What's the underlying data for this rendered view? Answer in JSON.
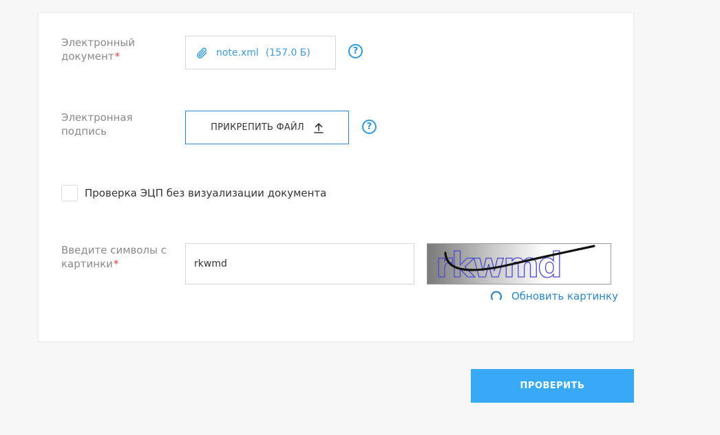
{
  "form": {
    "document": {
      "label_line1": "Электронный",
      "label_line2": "документ",
      "required_mark": "*",
      "file_name": "note.xml",
      "file_size": "(157.0 Б)",
      "help_glyph": "?"
    },
    "signature": {
      "label_line1": "Электронная",
      "label_line2": "подпись",
      "attach_label": "ПРИКРЕПИТЬ ФАЙЛ",
      "help_glyph": "?"
    },
    "checkbox": {
      "label": "Проверка ЭЦП без визуализации документа",
      "checked": false
    },
    "captcha": {
      "label_line1": "Введите символы с",
      "label_line2": "картинки",
      "required_mark": "*",
      "input_value": "rkwmd",
      "image_text": "rkwmd",
      "refresh_label": "Обновить картинку"
    },
    "submit_label": "ПРОВЕРИТЬ"
  },
  "icons": {
    "attachment": "paperclip-icon",
    "upload": "upload-arrow-icon",
    "help": "question-circle-icon",
    "refresh": "refresh-icon"
  },
  "colors": {
    "accent": "#2a9bd8",
    "link": "#2a86c9",
    "primary_button": "#38a9f4",
    "required": "#e2443c",
    "label": "#8a8a8a"
  }
}
